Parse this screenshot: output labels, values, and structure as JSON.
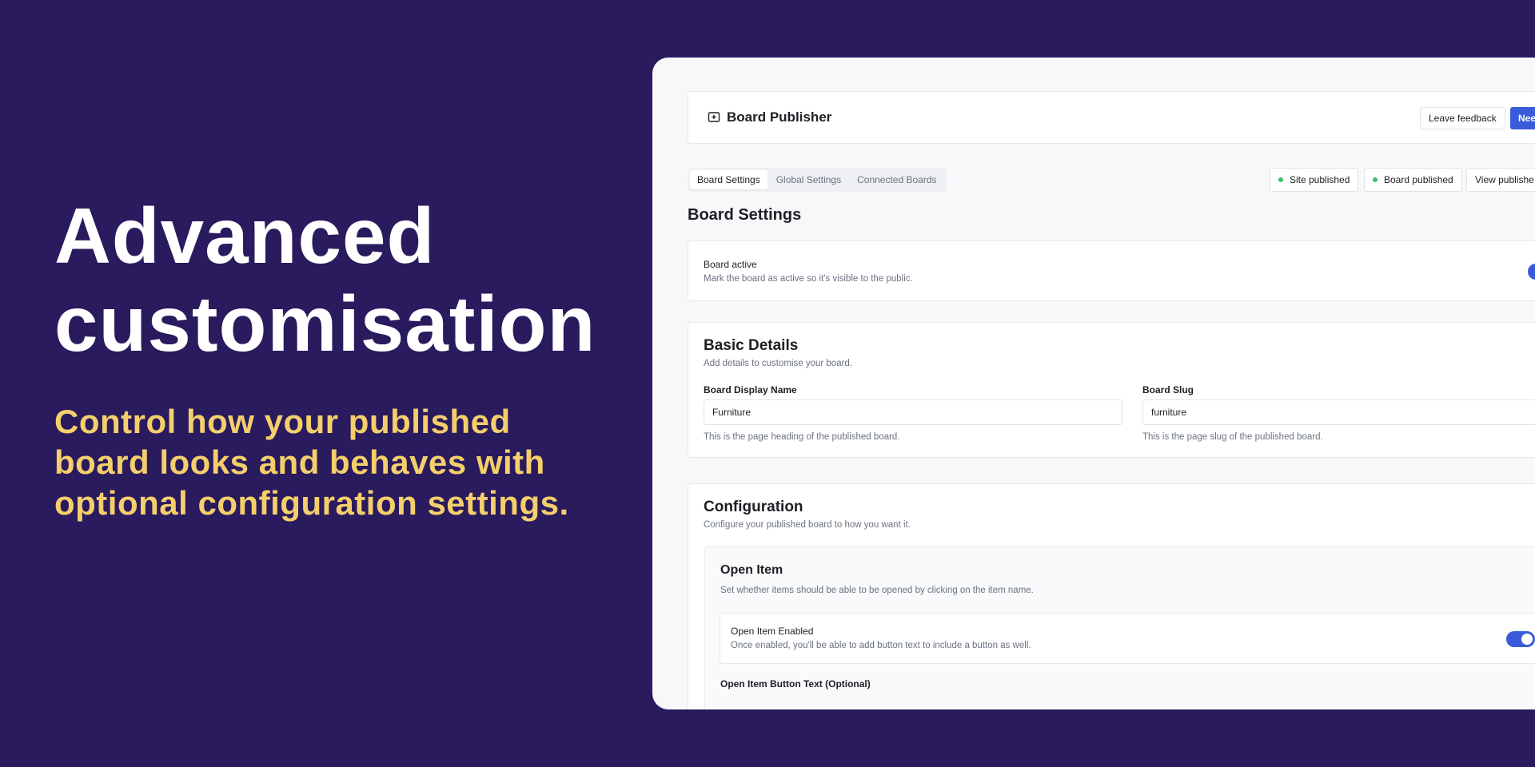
{
  "hero": {
    "title_line1": "Advanced",
    "title_line2": "customisation",
    "subtitle_line1": "Control how your published",
    "subtitle_line2": "board looks and behaves with",
    "subtitle_line3": "optional configuration settings."
  },
  "app": {
    "title": "Board Publisher",
    "icon": "board-upload-icon",
    "buttons": {
      "leave_feedback": "Leave feedback",
      "need_help": "Need h"
    }
  },
  "tabs": [
    {
      "label": "Board Settings",
      "active": true
    },
    {
      "label": "Global Settings",
      "active": false
    },
    {
      "label": "Connected Boards",
      "active": false
    }
  ],
  "status": {
    "site_published": "Site published",
    "board_published": "Board published",
    "view_published": "View publishe"
  },
  "page": {
    "heading": "Board Settings"
  },
  "board_active": {
    "label": "Board active",
    "description": "Mark the board as active so it's visible to the public."
  },
  "basic_details": {
    "title": "Basic Details",
    "description": "Add details to customise your board.",
    "display_name": {
      "label": "Board Display Name",
      "value": "Furniture",
      "hint": "This is the page heading of the published board."
    },
    "slug": {
      "label": "Board Slug",
      "value": "furniture",
      "hint": "This is the page slug of the published board."
    }
  },
  "configuration": {
    "title": "Configuration",
    "description": "Configure your published board to how you want it.",
    "open_item": {
      "title": "Open Item",
      "description": "Set whether items should be able to be opened by clicking on the item name.",
      "enabled_label": "Open Item Enabled",
      "enabled_description": "Once enabled, you'll be able to add button text to include a button as well.",
      "enabled": true,
      "button_text_label": "Open Item Button Text (Optional)"
    }
  },
  "colors": {
    "background": "#2a1a5e",
    "accent_yellow": "#f5cf6b",
    "primary_blue": "#3a5bd9",
    "status_green": "#3fbf6b"
  }
}
